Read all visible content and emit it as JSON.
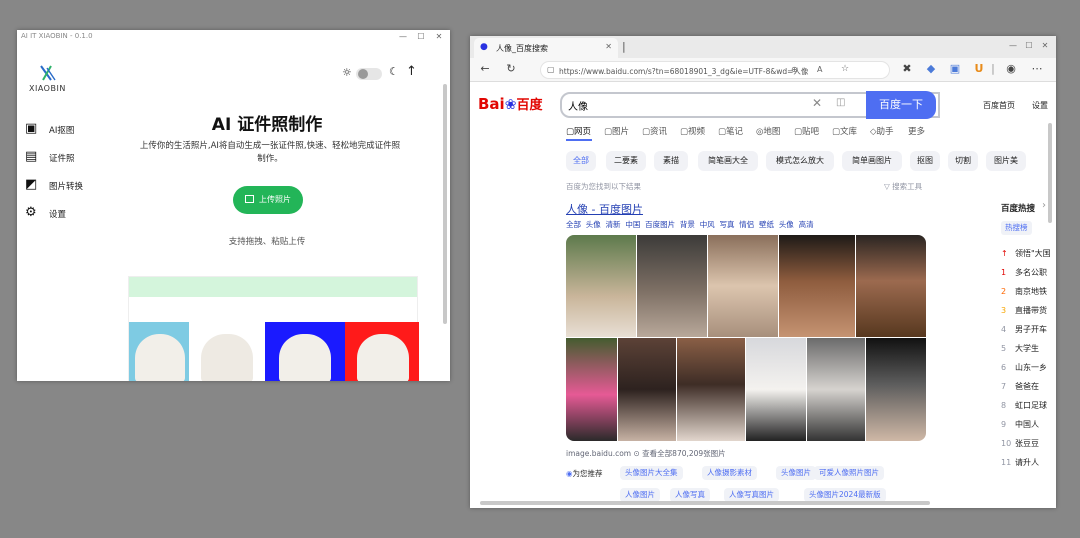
{
  "app_window": {
    "title": "AI IT XIAOBIN - 0.1.0",
    "brand": "XIAOBIN",
    "heading": "AI 证件照制作",
    "desc_line1": "上传你的生活照片,AI将自动生成一张证件照,快速、轻松地完成证件照",
    "desc_line2": "制作。",
    "upload_label": "上传照片",
    "hint": "支持拖拽、粘贴上传",
    "sidebar": [
      {
        "label": "AI抠图",
        "icon": "image-cutout-icon"
      },
      {
        "label": "证件照",
        "icon": "id-card-icon"
      },
      {
        "label": "图片转换",
        "icon": "image-convert-icon"
      },
      {
        "label": "设置",
        "icon": "gear-icon"
      }
    ],
    "sample_colors": [
      "#7ecbe3",
      "#ffffff",
      "#1a1aff",
      "#ff1a1a"
    ]
  },
  "browser": {
    "tab_title": "人像_百度搜索",
    "url": "https://www.baidu.com/s?tn=68018901_3_dg&ie=UTF-8&wd=人像",
    "logo_text": "Bai",
    "logo_text2": "百度",
    "search_value": "人像",
    "search_button": "百度一下",
    "top_links": [
      "百度首页",
      "设置"
    ],
    "nav": [
      "网页",
      "图片",
      "资讯",
      "视频",
      "笔记",
      "地图",
      "贴吧",
      "文库",
      "助手",
      "更多"
    ],
    "chips": [
      "全部",
      "二要素",
      "素描",
      "简笔画大全",
      "模式怎么放大",
      "简单画图片",
      "抠图",
      "切割",
      "图片美"
    ],
    "result_meta": "百度为您找到以下结果",
    "tools": "搜索工具",
    "result_title": "人像 - 百度图片",
    "sub_tabs": [
      "全部",
      "头像",
      "清新",
      "中国",
      "百度图片",
      "背景",
      "中风",
      "写真",
      "情侣",
      "壁纸",
      "头像",
      "高清"
    ],
    "source": "image.baidu.com",
    "source_count": "查看全部870,209张图片",
    "related_label": "为您推荐",
    "related_row1": [
      "头像图片大全集",
      "人像摄影素材",
      "头像图片",
      "可爱人像照片图片"
    ],
    "related_row2": [
      "人像图片",
      "人像写真",
      "人像写真图片",
      "头像图片2024最新版"
    ],
    "hot_title": "百度热搜",
    "hot_tab": "热搜榜",
    "hot_items": [
      {
        "n": "",
        "t": "领悟\"大国"
      },
      {
        "n": "1",
        "t": "多名公职"
      },
      {
        "n": "2",
        "t": "南京地铁"
      },
      {
        "n": "3",
        "t": "直播带货"
      },
      {
        "n": "4",
        "t": "男子开车"
      },
      {
        "n": "5",
        "t": "大学生"
      },
      {
        "n": "6",
        "t": "山东一乡"
      },
      {
        "n": "7",
        "t": "爸爸在"
      },
      {
        "n": "8",
        "t": "虹口足球"
      },
      {
        "n": "9",
        "t": "中国人"
      },
      {
        "n": "10",
        "t": "张豆豆"
      },
      {
        "n": "11",
        "t": "请升人"
      }
    ]
  },
  "colors": {
    "accent_green": "#23b558",
    "baidu_blue": "#4e6ef2",
    "baidu_red": "#e10602"
  }
}
